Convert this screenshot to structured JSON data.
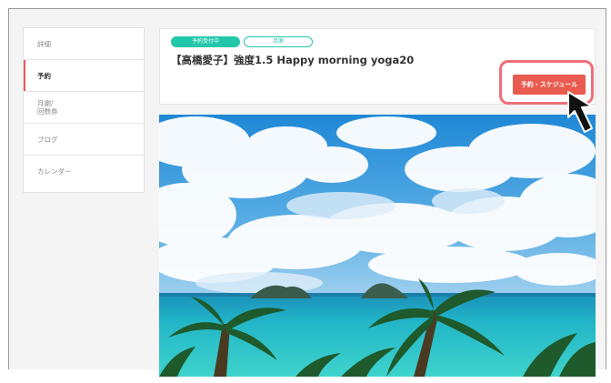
{
  "sidebar": {
    "items": [
      {
        "label": "詳細"
      },
      {
        "label": "予約"
      },
      {
        "label": "月謝/",
        "label2": "回数券"
      },
      {
        "label": "ブログ"
      },
      {
        "label": "カレンダー"
      }
    ]
  },
  "lesson": {
    "status_badge": "予約受付中",
    "type_badge": "月謝",
    "title": "【高橋愛子】強度1.5 Happy morning yoga20",
    "reserve_button": "予約・スケジュール"
  },
  "colors": {
    "accent_green": "#22c7a9",
    "reserve_red": "#ea5b4f",
    "highlight_pink": "#f06e78"
  },
  "icons": {
    "cursor": "arrow-pointer-icon"
  }
}
